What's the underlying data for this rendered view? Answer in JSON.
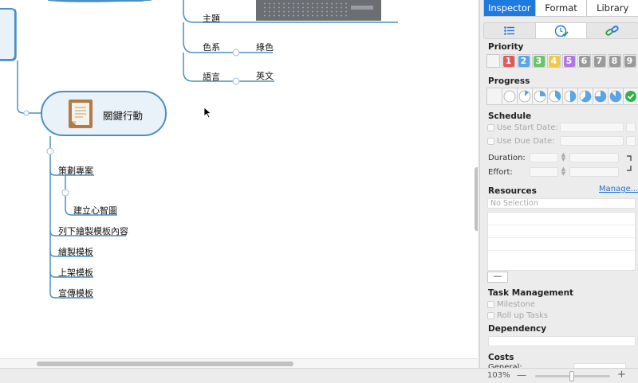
{
  "canvas": {
    "branches": {
      "theme": "主題",
      "color_scheme": "色系",
      "color_scheme_value": "綠色",
      "language": "語言",
      "language_value": "英文"
    },
    "main_node": {
      "title": "關鍵行動",
      "icon": "document-icon"
    },
    "children": {
      "plan_project": "策劃專案",
      "build_mindmap": "建立心智圖",
      "list_template_content": "列下繪製模板內容",
      "draw_template": "繪製模板",
      "publish_template": "上架模板",
      "promote_template": "宣傳模板"
    }
  },
  "inspector": {
    "tabs": [
      {
        "label": "Inspector",
        "active": true
      },
      {
        "label": "Format",
        "active": false
      },
      {
        "label": "Library",
        "active": false
      }
    ],
    "subtabs": [
      "list-icon",
      "clock-check-icon",
      "link-icon"
    ],
    "priority": {
      "label": "Priority",
      "items": [
        {
          "text": "",
          "color": "#f4f4f4"
        },
        {
          "text": "1",
          "color": "#e05a5a"
        },
        {
          "text": "2",
          "color": "#5aa4e8"
        },
        {
          "text": "3",
          "color": "#6cc46c"
        },
        {
          "text": "4",
          "color": "#f0c84a"
        },
        {
          "text": "5",
          "color": "#b278e0"
        },
        {
          "text": "6",
          "color": "#9a9a9a"
        },
        {
          "text": "7",
          "color": "#9a9a9a"
        },
        {
          "text": "8",
          "color": "#9a9a9a"
        },
        {
          "text": "9",
          "color": "#9a9a9a"
        }
      ]
    },
    "progress": {
      "label": "Progress",
      "levels": [
        0,
        0,
        0.125,
        0.25,
        0.375,
        0.5,
        0.625,
        0.75,
        0.875,
        1.0
      ]
    },
    "schedule": {
      "label": "Schedule",
      "use_start_date": "Use Start Date:",
      "use_due_date": "Use Due Date:",
      "duration": "Duration:",
      "effort": "Effort:"
    },
    "resources": {
      "label": "Resources",
      "manage": "Manage...",
      "selection": "No Selection",
      "remove": "—"
    },
    "task_management": {
      "label": "Task Management",
      "milestone": "Milestone",
      "roll_up": "Roll up Tasks"
    },
    "dependency": {
      "label": "Dependency"
    },
    "costs": {
      "label": "Costs",
      "general": "General:"
    }
  },
  "statusbar": {
    "zoom": "103%",
    "zoom_out": "—",
    "zoom_in": "+"
  },
  "colors": {
    "accent": "#1f7ae0",
    "branch_line": "#4a8fc4",
    "node_fill": "#e9f1f9"
  }
}
